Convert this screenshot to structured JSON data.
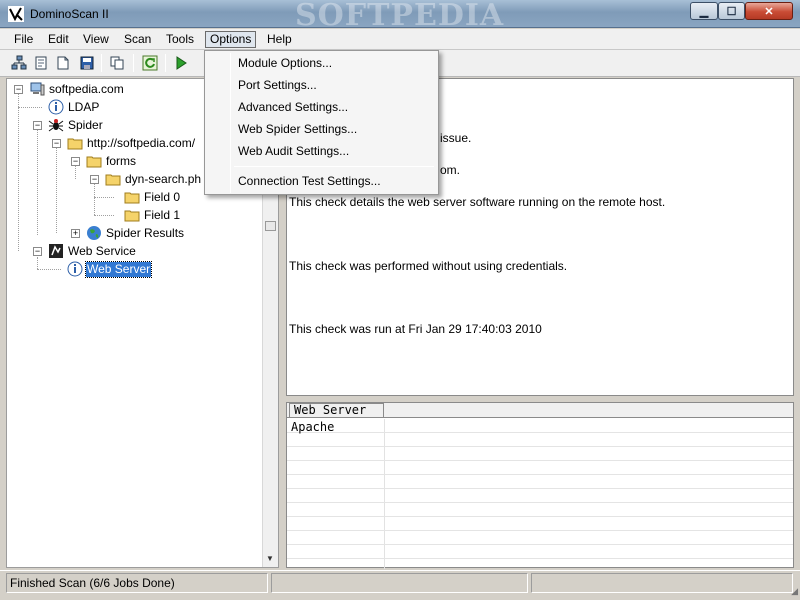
{
  "window": {
    "title": "DominoScan II",
    "watermark": "SOFTPEDIA"
  },
  "title_buttons": {
    "minimize": "▁",
    "maximize": "☐",
    "close": "✕"
  },
  "menubar": [
    "File",
    "Edit",
    "View",
    "Scan",
    "Tools",
    "Options",
    "Help"
  ],
  "options_menu": {
    "items": [
      "Module Options...",
      "Port Settings...",
      "Advanced Settings...",
      "Web Spider Settings...",
      "Web Audit Settings..."
    ],
    "after_separator": "Connection Test Settings..."
  },
  "toolbar_icons": [
    "network-scan-icon",
    "document-icon",
    "open-file-icon",
    "save-icon",
    "copy-icon",
    "refresh-icon",
    "run-icon"
  ],
  "tree": {
    "root": "softpedia.com",
    "ldap": "LDAP",
    "spider": "Spider",
    "url": "http://softpedia.com/",
    "forms": "forms",
    "dyn": "dyn-search.ph",
    "field0": "Field 0",
    "field1": "Field 1",
    "results": "Spider Results",
    "webservice": "Web Service",
    "webserver": "Web Server"
  },
  "detail": {
    "line1": "issue.",
    "line2": "om.",
    "line3": "This check details the web server software running on the remote host.",
    "line4": "This check was performed without using credentials.",
    "line5": "This check was run at Fri Jan 29 17:40:03 2010"
  },
  "table": {
    "header": "Web Server",
    "rows": [
      "Apache"
    ]
  },
  "status": {
    "text": "Finished Scan  (6/6 Jobs Done)",
    "panel2": "",
    "panel3": ""
  },
  "colors": {
    "accent": "#3178d3",
    "titlebar": "#8aa5c1",
    "menu_bg": "#f0f0f0"
  }
}
